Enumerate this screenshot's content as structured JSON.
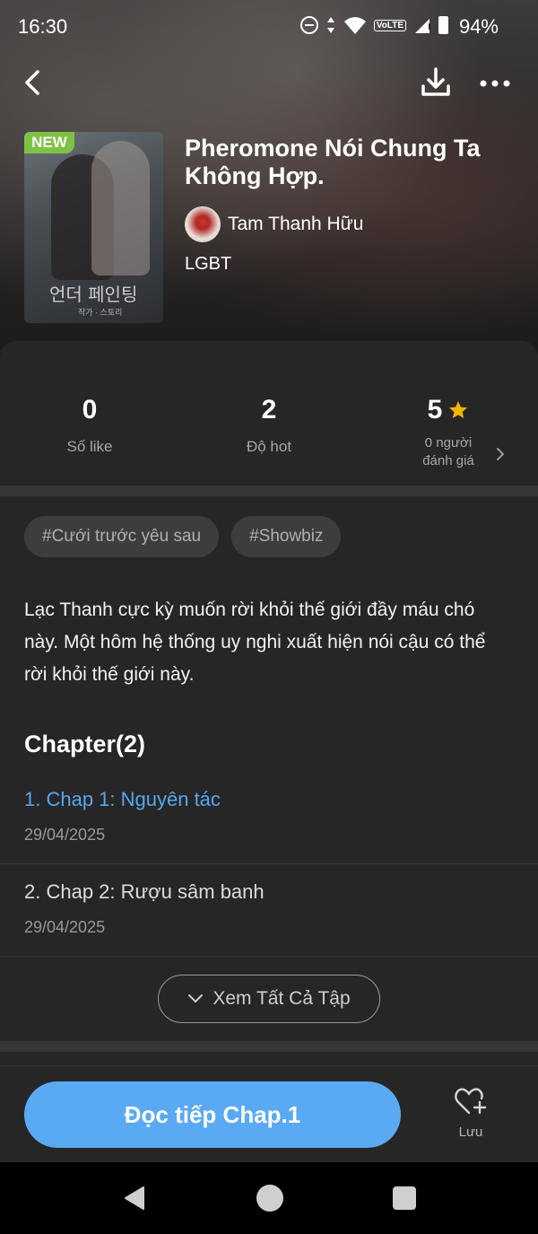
{
  "status_bar": {
    "time": "16:30",
    "network": "VoLTE",
    "battery": "94%"
  },
  "toolbar": {
    "back_icon": "chevron-left-icon",
    "download_icon": "download-icon",
    "more_icon": "more-horizontal-icon"
  },
  "comic": {
    "badge": "NEW",
    "cover_title": "언더 페인팅",
    "cover_subtitle": "작가 · 스토리",
    "title": "Pheromone Nói Chung Ta Không Hợp.",
    "author": "Tam Thanh Hữu",
    "genre": "LGBT"
  },
  "stats": [
    {
      "value": "0",
      "label": "Số like"
    },
    {
      "value": "2",
      "label": "Độ hot"
    },
    {
      "value": "5",
      "label_line1": "0 người",
      "label_line2": "đánh giá"
    }
  ],
  "tags": [
    "#Cưới trước yêu sau",
    "#Showbiz"
  ],
  "description": "Lạc Thanh cực kỳ muốn rời khỏi thế giới đầy máu chó này. Một hôm hệ thống uy nghi xuất hiện nói cậu có thể rời khỏi thế giới này.",
  "chapters": {
    "heading": "Chapter(2)",
    "items": [
      {
        "title": "1. Chap 1: Nguyên tác",
        "date": "29/04/2025"
      },
      {
        "title": "2. Chap 2: Rượu sâm banh",
        "date": "29/04/2025"
      }
    ],
    "see_all": "Xem Tất Cả Tập"
  },
  "actions": {
    "read": "Đọc tiếp Chap.1",
    "save": "Lưu"
  },
  "colors": {
    "accent": "#5aa9f3",
    "active_chapter": "#58a6f2",
    "new_badge": "#7ec245",
    "star": "#f5b400"
  }
}
